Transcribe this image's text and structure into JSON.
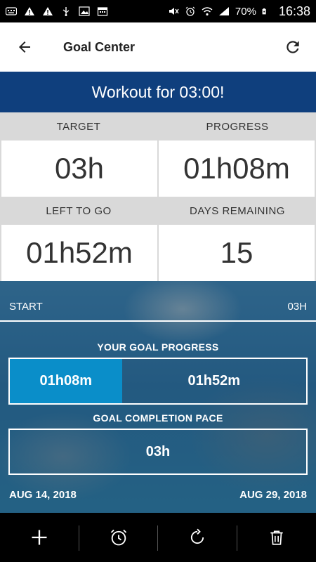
{
  "status_bar": {
    "battery_percent": "70%",
    "time": "16:38"
  },
  "app_bar": {
    "title": "Goal Center"
  },
  "banner": {
    "text": "Workout for 03:00!"
  },
  "stats": {
    "target_label": "TARGET",
    "target_value": "03h",
    "progress_label": "PROGRESS",
    "progress_value": "01h08m",
    "left_label": "LEFT TO GO",
    "left_value": "01h52m",
    "days_label": "DAYS REMAINING",
    "days_value": "15"
  },
  "progress": {
    "start_label": "START",
    "end_label": "03H",
    "goal_progress_title": "YOUR GOAL PROGRESS",
    "done_value": "01h08m",
    "remaining_value": "01h52m",
    "done_fraction": 0.378,
    "pace_title": "GOAL COMPLETION PACE",
    "pace_value": "03h",
    "start_date": "AUG 14, 2018",
    "end_date": "AUG 29, 2018"
  },
  "colors": {
    "banner_bg": "#0f3f7d",
    "progress_fill": "#0a8ec9",
    "stat_header_bg": "#d9d9d9"
  },
  "bottom_bar": {
    "icons": [
      "add-icon",
      "alarm-clock-icon",
      "reset-icon",
      "trash-icon"
    ]
  }
}
